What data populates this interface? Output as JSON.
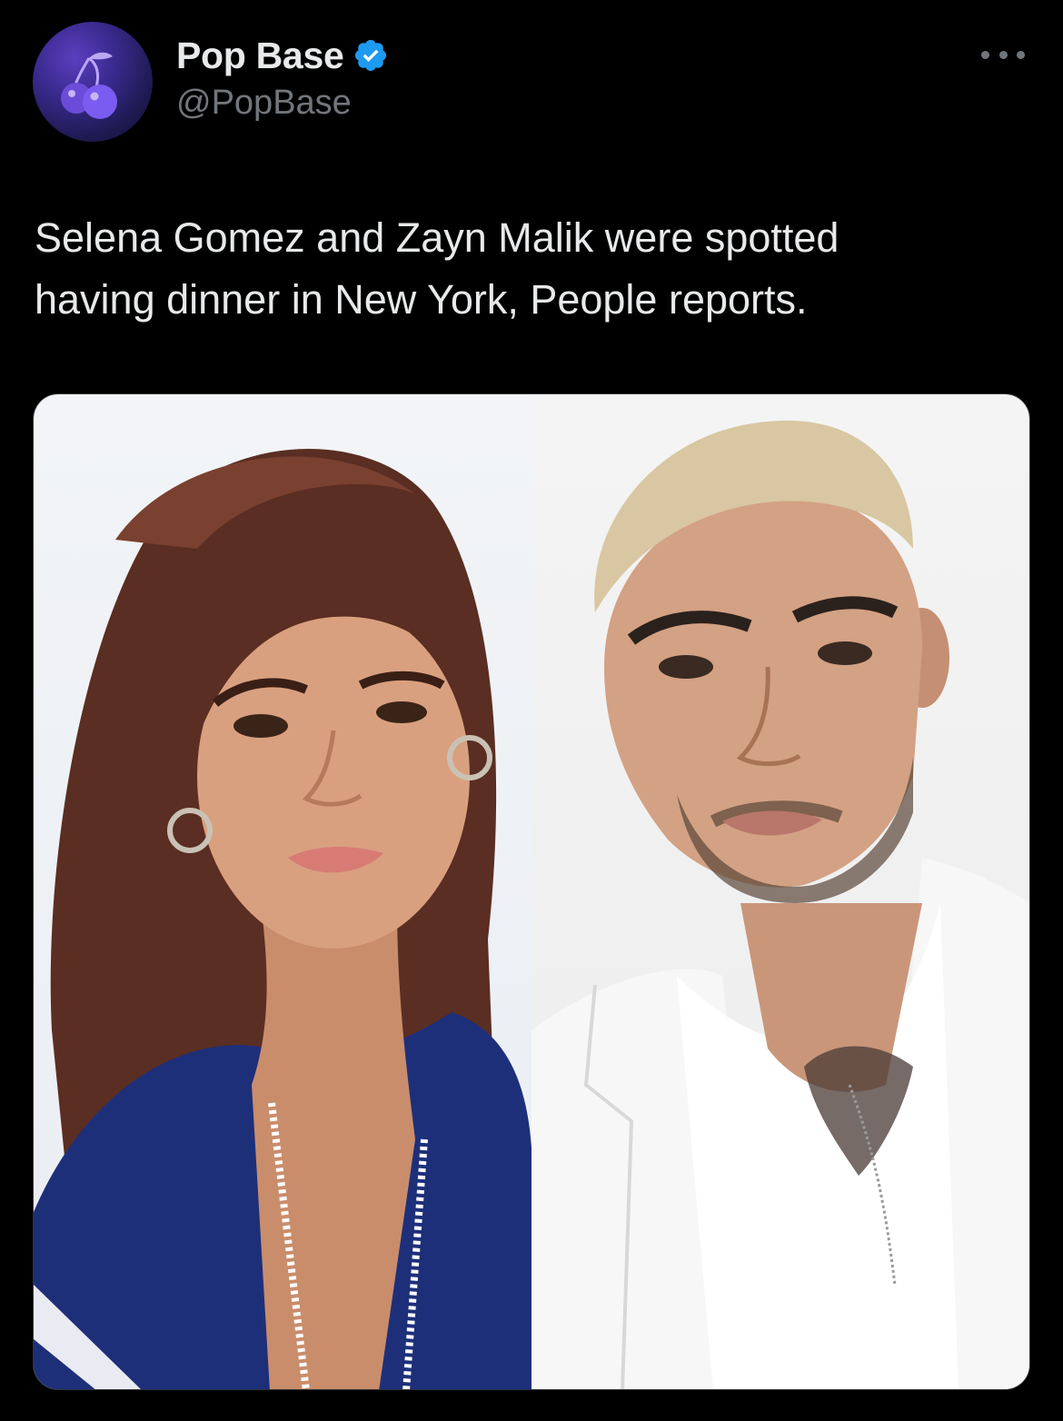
{
  "author": {
    "display_name": "Pop Base",
    "handle": "@PopBase",
    "verified": true,
    "avatar_icon": "cherry-icon"
  },
  "tweet": {
    "text": "Selena Gomez and Zayn Malik were spotted\nhaving dinner in New York, People reports."
  },
  "colors": {
    "background": "#000000",
    "primary_text": "#e7e9ea",
    "secondary_text": "#71767b",
    "verified_blue": "#1d9bf0"
  },
  "media": {
    "photos": [
      {
        "name": "photo-left"
      },
      {
        "name": "photo-right"
      }
    ]
  }
}
